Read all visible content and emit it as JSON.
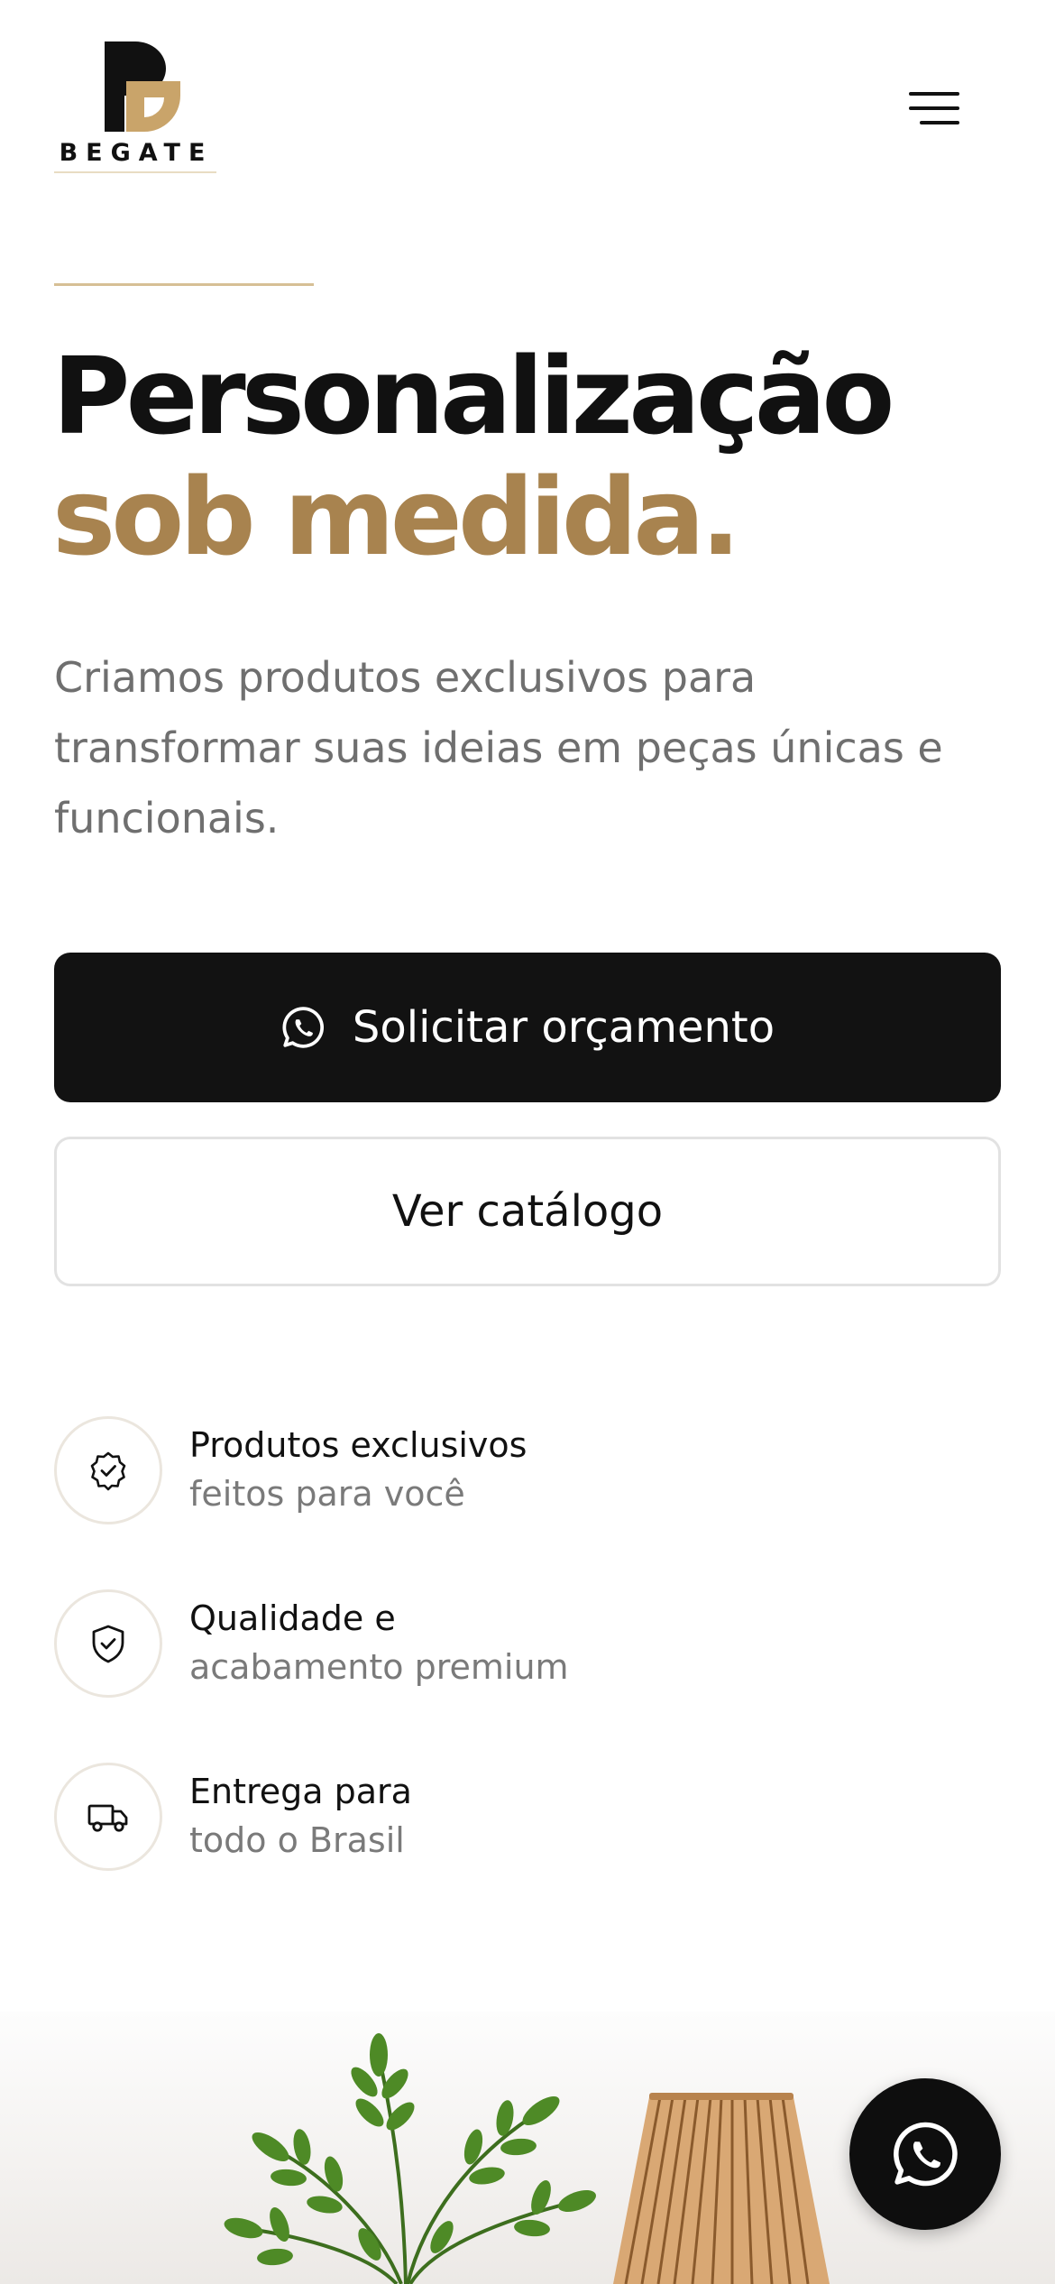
{
  "header": {
    "logo_text": "BEGATE",
    "menu_icon": "hamburger-menu-icon"
  },
  "hero": {
    "title_line1": "Personalização",
    "title_line2": "sob medida.",
    "subtitle": "Criamos produtos exclusivos para transformar suas ideias em peças únicas e funcionais."
  },
  "buttons": {
    "primary_label": "Solicitar orçamento",
    "primary_icon": "whatsapp-icon",
    "secondary_label": "Ver catálogo"
  },
  "features": [
    {
      "icon": "check-badge-icon",
      "title": "Produtos exclusivos",
      "subtitle": "feitos para você"
    },
    {
      "icon": "shield-check-icon",
      "title": "Qualidade e",
      "subtitle": "acabamento premium"
    },
    {
      "icon": "truck-icon",
      "title": "Entrega para",
      "subtitle": "todo o Brasil"
    }
  ],
  "floating_button": {
    "icon": "whatsapp-icon"
  },
  "colors": {
    "accent_gold": "#a8834f",
    "text_dark": "#111111",
    "text_muted": "#6f6f6f",
    "button_dark": "#121212"
  }
}
